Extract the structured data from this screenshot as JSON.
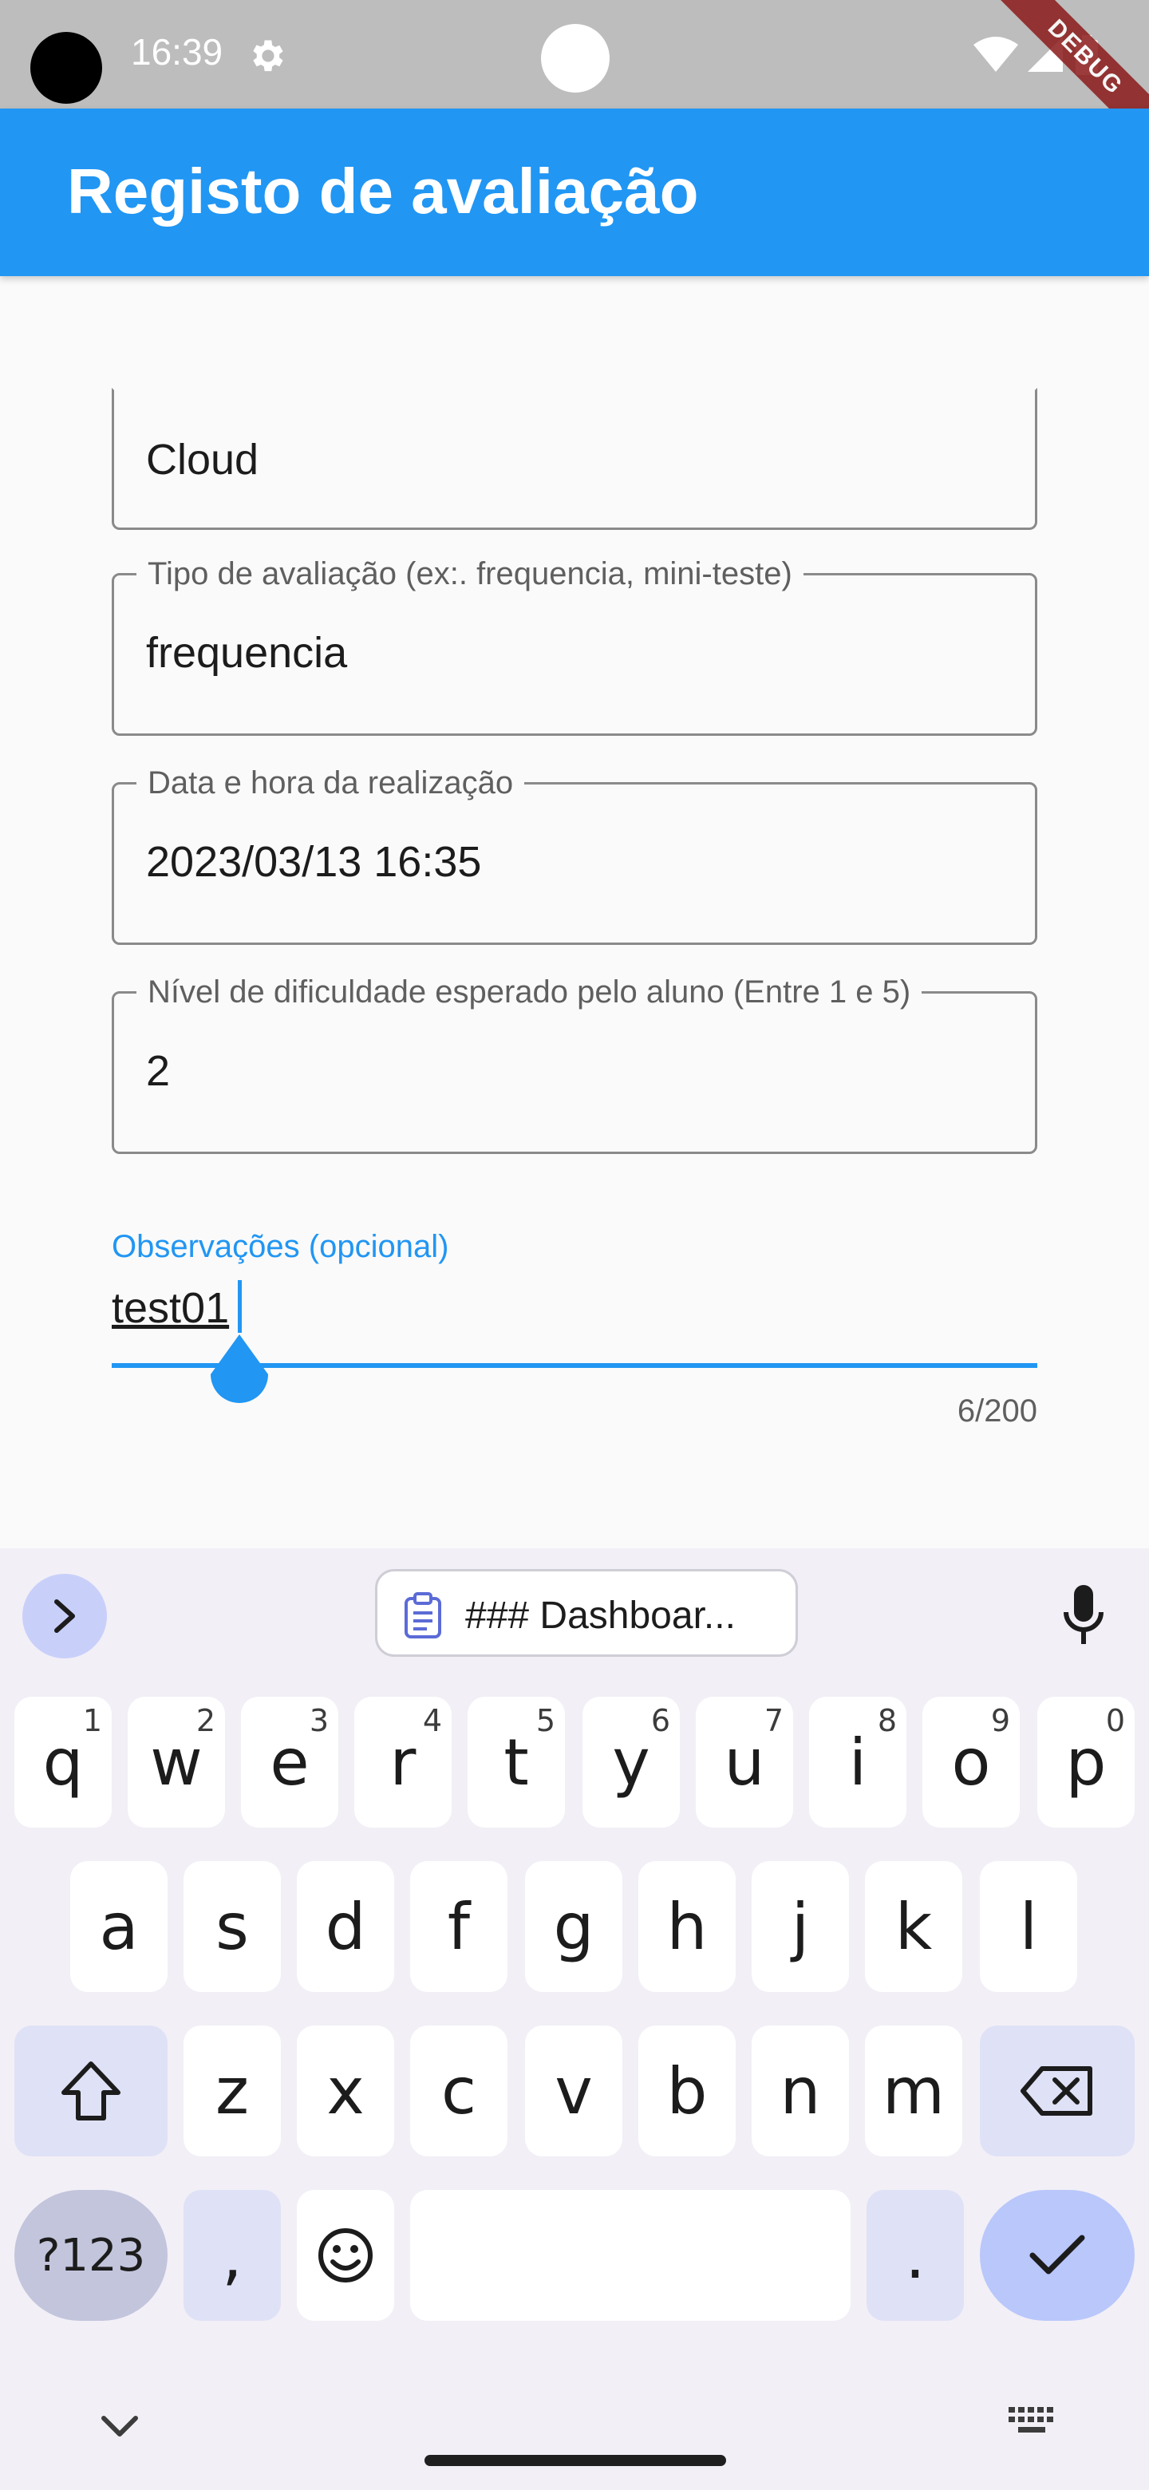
{
  "status_bar": {
    "time": "16:39",
    "debug_label": "DEBUG"
  },
  "app_bar": {
    "title": "Registo de avaliação"
  },
  "form": {
    "fields": [
      {
        "label": "",
        "value": "Cloud"
      },
      {
        "label": "Tipo de avaliação (ex:. frequencia, mini-teste)",
        "value": "frequencia"
      },
      {
        "label": "Data e hora da realização",
        "value": "2023/03/13 16:35"
      },
      {
        "label": "Nível de dificuldade esperado pelo aluno (Entre 1 e 5)",
        "value": "2"
      }
    ],
    "observations": {
      "label": "Observações (opcional)",
      "value": "test01",
      "counter": "6/200"
    }
  },
  "keyboard": {
    "clipboard_suggestion": "### Dashboar...",
    "row1": [
      {
        "key": "q",
        "hint": "1"
      },
      {
        "key": "w",
        "hint": "2"
      },
      {
        "key": "e",
        "hint": "3"
      },
      {
        "key": "r",
        "hint": "4"
      },
      {
        "key": "t",
        "hint": "5"
      },
      {
        "key": "y",
        "hint": "6"
      },
      {
        "key": "u",
        "hint": "7"
      },
      {
        "key": "i",
        "hint": "8"
      },
      {
        "key": "o",
        "hint": "9"
      },
      {
        "key": "p",
        "hint": "0"
      }
    ],
    "row2": [
      "a",
      "s",
      "d",
      "f",
      "g",
      "h",
      "j",
      "k",
      "l"
    ],
    "row3": [
      "z",
      "x",
      "c",
      "v",
      "b",
      "n",
      "m"
    ],
    "symbols_label": "?123",
    "comma": ",",
    "period": ".",
    "icons": [
      "chevron-right-icon",
      "clipboard-icon",
      "microphone-icon",
      "shift-icon",
      "backspace-icon",
      "emoji-icon",
      "checkmark-icon",
      "chevron-down-icon",
      "keyboard-icon"
    ]
  },
  "colors": {
    "primary": "#2196f3",
    "keyboard_bg": "#f2eff6",
    "enter_key": "#b9c7fb"
  }
}
